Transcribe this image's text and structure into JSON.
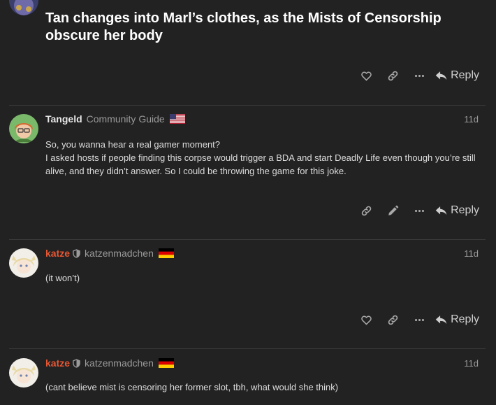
{
  "topic": {
    "title": "Tan changes into Marl’s clothes, as the Mists of Censorship obscure her body"
  },
  "actions": {
    "reply_label": "Reply"
  },
  "posts": [
    {
      "username": "Tangeld",
      "user_title": "Community Guide",
      "flag": "us-flag-icon",
      "date": "11d",
      "lines": [
        "So, you wanna hear a real gamer moment?",
        "I asked hosts if people finding this corpse would trigger a BDA and start Deadly Life even though you’re still alive, and they didn’t answer. So I could be throwing the game for this joke."
      ]
    },
    {
      "username": "katze",
      "full_name": "katzenmadchen",
      "flag": "de-flag-icon",
      "date": "11d",
      "lines": [
        "(it won’t)"
      ]
    },
    {
      "username": "katze",
      "full_name": "katzenmadchen",
      "flag": "de-flag-icon",
      "date": "11d",
      "lines": [
        "(cant believe mist is censoring her former slot, tbh, what would she think)"
      ]
    }
  ],
  "colors": {
    "background": "#222222",
    "staff_name": "#e45735",
    "muted": "#9a9a9a"
  }
}
